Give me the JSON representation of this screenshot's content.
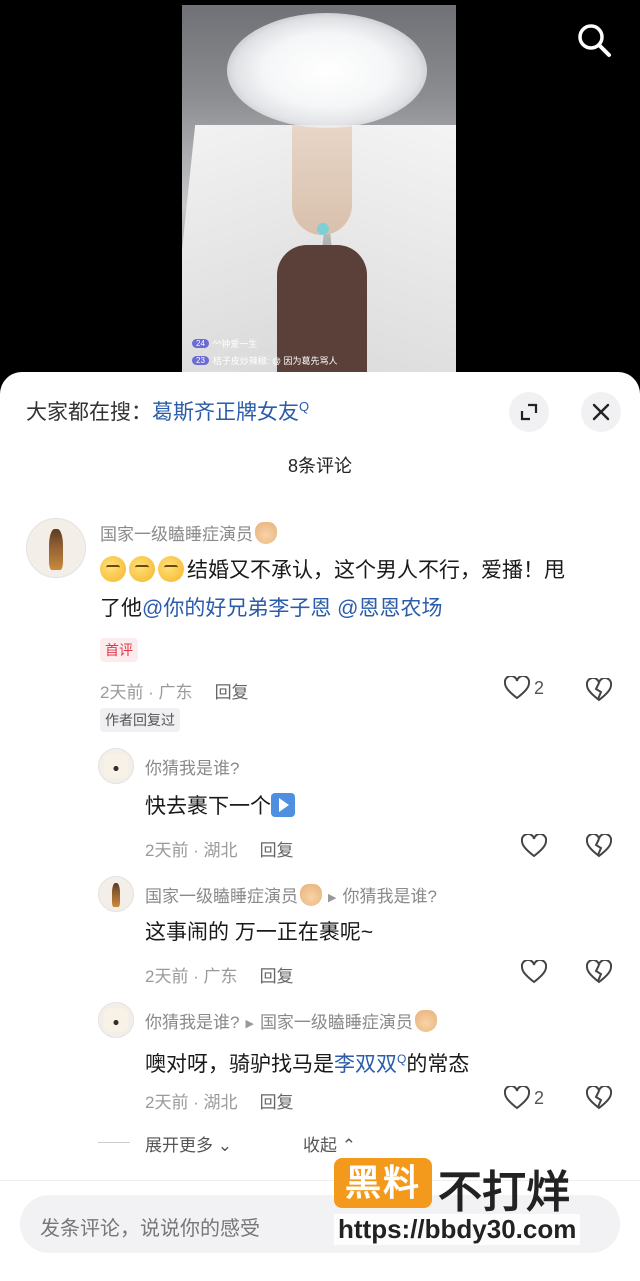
{
  "video": {
    "live_comments": [
      {
        "badge": "24",
        "text": "^^钟爱一生"
      },
      {
        "badge": "23",
        "text": "桔子皮炒辣椒: @ 因为葛先骂人"
      }
    ]
  },
  "sheet": {
    "hot_search_prefix": "大家都在搜：",
    "hot_search_keyword": "葛斯齐正牌女友",
    "comment_count": "8条评论"
  },
  "comments": [
    {
      "user": "国家一级瞌睡症演员",
      "text_plain": "结婚又不承认，这个男人不行，爱播！甩了他",
      "mention1": "@你的好兄弟李子恩",
      "mention2": "@恩恩农场",
      "tag_first": "首评",
      "meta": "2天前 · 广东",
      "reply": "回复",
      "likes": "2",
      "tag_author": "作者回复过"
    },
    {
      "user": "你猜我是谁?",
      "text": "快去裹下一个",
      "meta": "2天前 · 湖北",
      "reply": "回复"
    },
    {
      "user": "国家一级瞌睡症演员",
      "reply_to": "你猜我是谁?",
      "text": "这事闹的 万一正在裹呢~",
      "meta": "2天前 · 广东",
      "reply": "回复"
    },
    {
      "user": "你猜我是谁?",
      "reply_to": "国家一级瞌睡症演员",
      "text_before": "噢对呀，骑驴找马是",
      "mention": "李双双",
      "text_after": "的常态",
      "meta": "2天前 · 湖北",
      "reply": "回复",
      "likes": "2"
    }
  ],
  "expand": {
    "more": "展开更多",
    "collapse": "收起"
  },
  "input": {
    "placeholder": "发条评论，说说你的感受"
  },
  "watermark": {
    "logo": "黑料",
    "title": "不打烊",
    "url": "https://bbdy30.com"
  }
}
